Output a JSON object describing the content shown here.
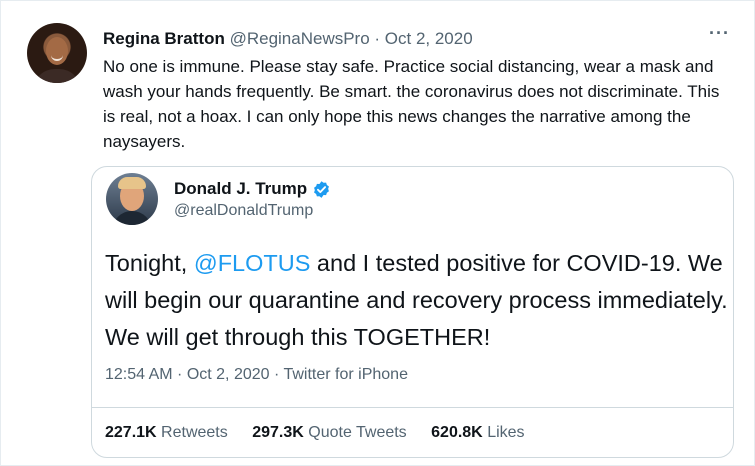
{
  "tweet": {
    "author_name": "Regina Bratton",
    "meta": "@ReginaNewsPro · Oct 2, 2020",
    "more_label": "···",
    "text": "No one is immune. Please stay safe. Practice social distancing, wear a mask and wash your hands frequently. Be smart. the coronavirus does not discriminate. This is real, not a hoax. I can only hope this news changes the narrative among the naysayers."
  },
  "quoted": {
    "author_name": "Donald J. Trump",
    "handle": "@realDonaldTrump",
    "text_before": "Tonight, ",
    "mention": "@FLOTUS",
    "text_after": " and I tested positive for COVID-19. We will begin our quarantine and recovery process immediately. We will get through this TOGETHER!",
    "timestamp": "12:54 AM · Oct 2, 2020 · Twitter for iPhone",
    "stats": [
      {
        "value": "227.1K",
        "label": "Retweets"
      },
      {
        "value": "297.3K",
        "label": "Quote Tweets"
      },
      {
        "value": "620.8K",
        "label": "Likes"
      }
    ]
  },
  "colors": {
    "accent": "#1d9bf0",
    "secondary_text": "#536471",
    "border": "#cfd9de"
  },
  "icons": [
    "more-icon",
    "verified-badge-icon"
  ]
}
